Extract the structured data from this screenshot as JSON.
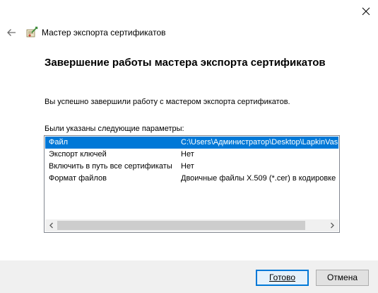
{
  "window": {
    "title": "Мастер экспорта сертификатов"
  },
  "page": {
    "heading": "Завершение работы мастера экспорта сертификатов",
    "success_text": "Вы успешно завершили работу с мастером экспорта сертификатов.",
    "params_label": "Были указаны следующие параметры:"
  },
  "params": [
    {
      "name": "Файл",
      "value": "C:\\Users\\Администратор\\Desktop\\LapkinVasil"
    },
    {
      "name": "Экспорт ключей",
      "value": "Нет"
    },
    {
      "name": "Включить в путь все сертификаты",
      "value": "Нет"
    },
    {
      "name": "Формат файлов",
      "value": "Двоичные файлы X.509 (*.cer) в кодировке"
    }
  ],
  "buttons": {
    "ok_label": "Готово",
    "cancel_label": "Отмена"
  },
  "colors": {
    "selection": "#0078d7",
    "footer_bg": "#f0f0f0",
    "default_button_border": "#0078d7"
  },
  "icons": {
    "close": "close-icon",
    "back": "back-arrow-icon",
    "wizard": "certificate-wizard-icon",
    "scroll_left": "scroll-left-arrow-icon",
    "scroll_right": "scroll-right-arrow-icon"
  }
}
